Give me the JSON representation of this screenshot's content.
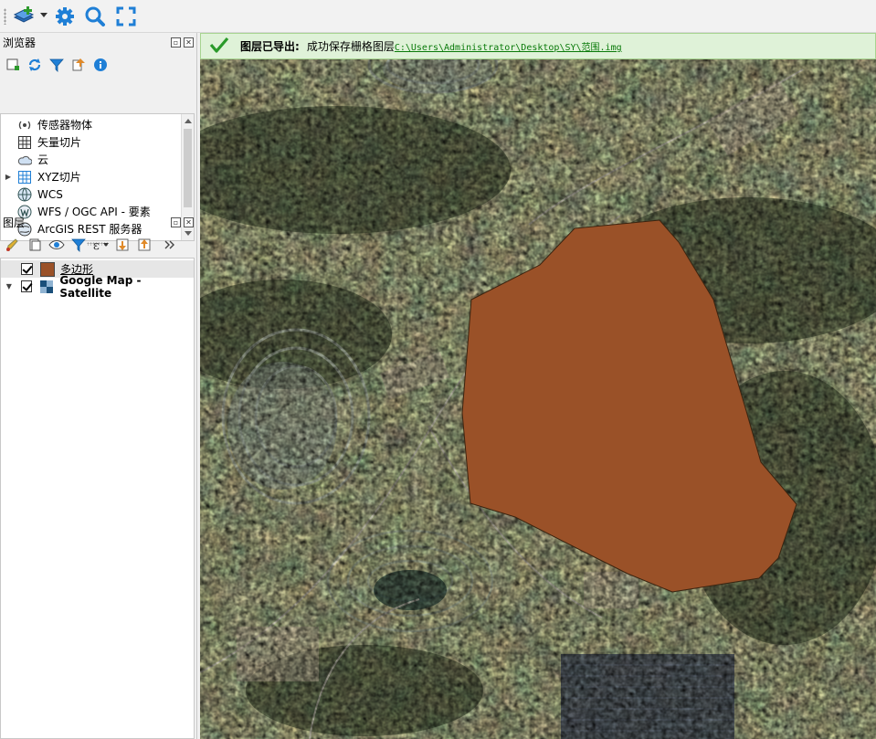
{
  "toolbar": {
    "buttons": [
      "add-layer-icon",
      "settings-gear-icon",
      "zoom-magnifier-icon",
      "fullscreen-icon"
    ]
  },
  "browser_panel": {
    "title": "浏览器",
    "items": [
      {
        "label": "传感器物体",
        "icon": "sensor-icon",
        "expandable": false
      },
      {
        "label": "矢量切片",
        "icon": "vector-tile-icon",
        "expandable": false
      },
      {
        "label": "云",
        "icon": "cloud-icon",
        "expandable": false
      },
      {
        "label": "XYZ切片",
        "icon": "xyz-tile-icon",
        "expandable": true
      },
      {
        "label": "WCS",
        "icon": "wcs-globe-icon",
        "expandable": false
      },
      {
        "label": "WFS / OGC API - 要素",
        "icon": "wfs-icon",
        "expandable": false
      },
      {
        "label": "ArcGIS REST 服务器",
        "icon": "arcgis-globe-icon",
        "expandable": false
      }
    ]
  },
  "layers_panel": {
    "title": "图层",
    "layers": [
      {
        "name": "多边形",
        "checked": true,
        "swatch": "#9a5128",
        "selected": true
      },
      {
        "name": "Google Map - Satellite",
        "checked": true,
        "swatch": "raster-icon",
        "expanded": true
      }
    ]
  },
  "message": {
    "title": "图层已导出:",
    "text": "成功保存栅格图层",
    "link": "C:\\Users\\Administrator\\Desktop\\SY\\范围.img"
  },
  "colors": {
    "polygon_fill": "#9a5128",
    "message_bg": "#dff2d8",
    "message_border": "#a7d490",
    "success_check": "#2a9a2a",
    "toolbar_icon_blue": "#1f7fd6"
  }
}
